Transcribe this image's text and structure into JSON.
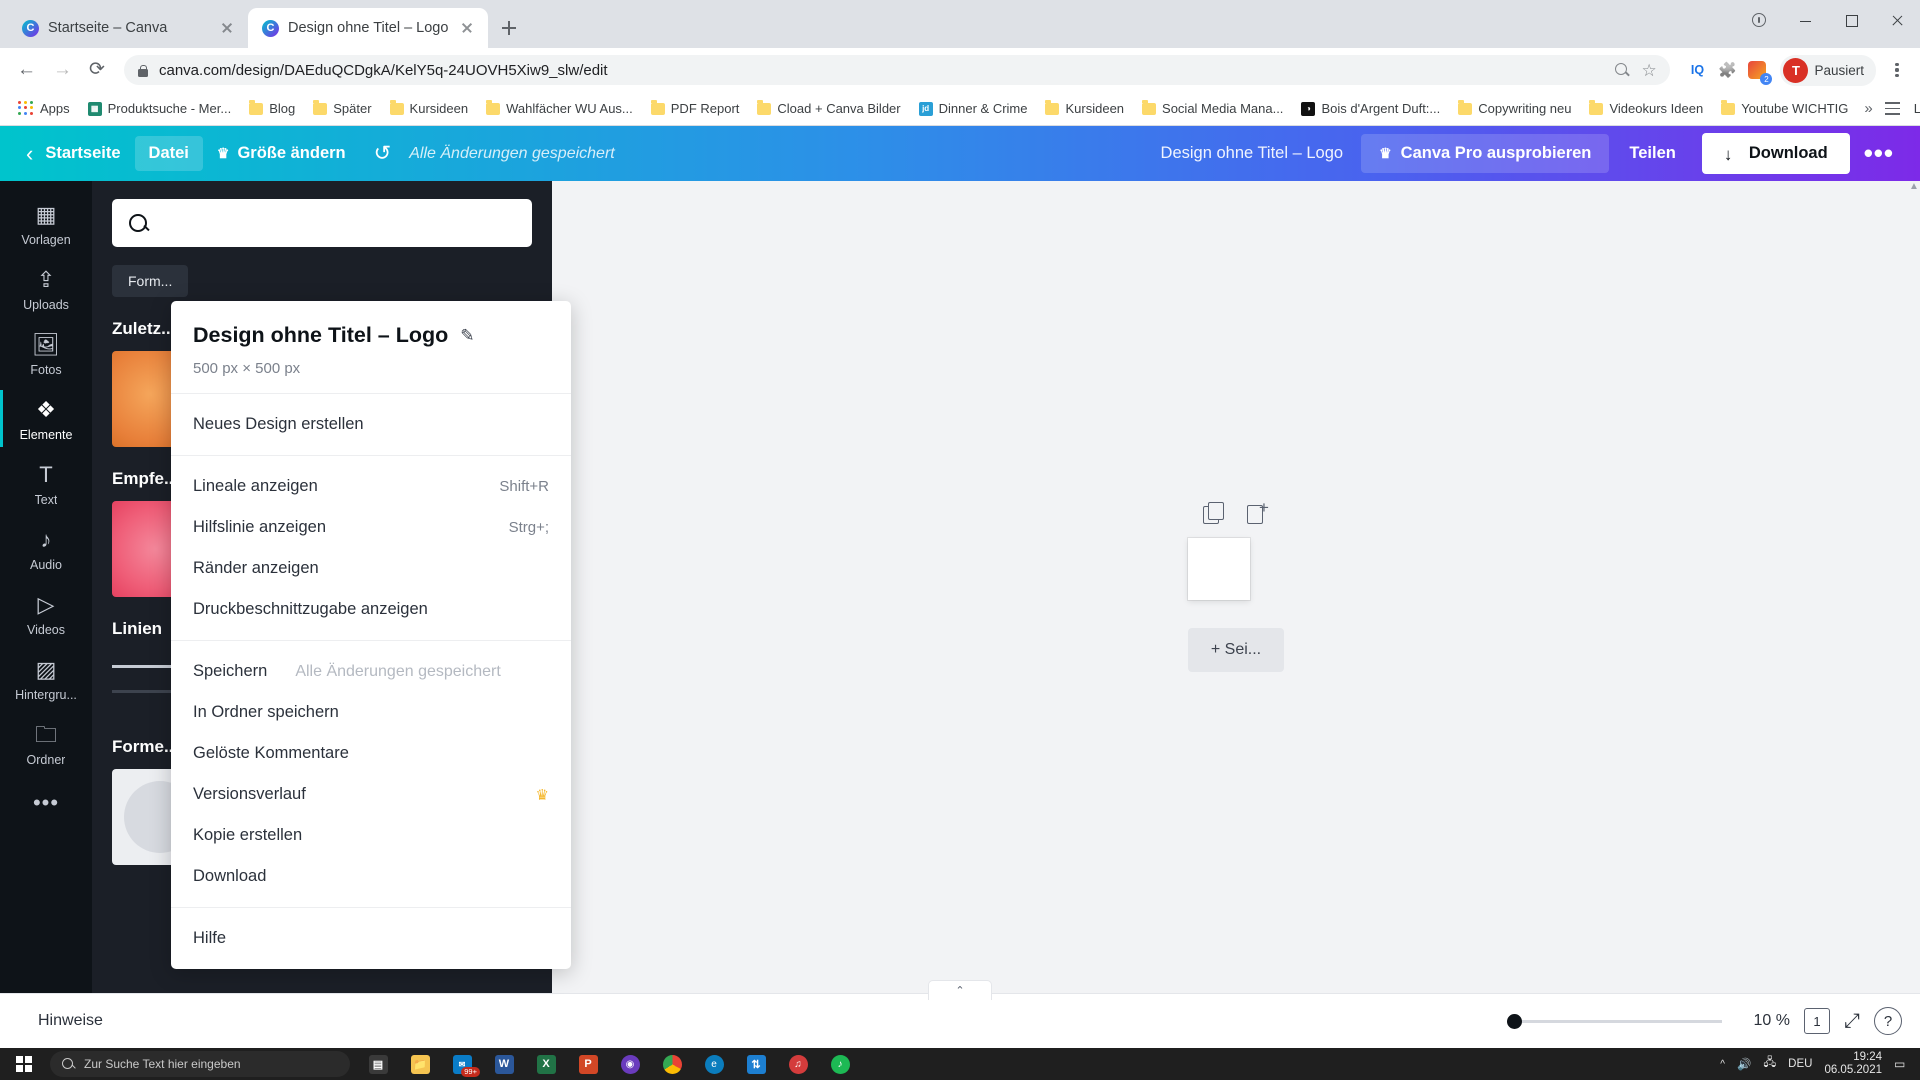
{
  "browser": {
    "tabs": [
      {
        "title": "Startseite – Canva",
        "active": false
      },
      {
        "title": "Design ohne Titel – Logo",
        "active": true
      }
    ],
    "newtab_label": "+",
    "url": "canva.com/design/DAEduQCDgkA/KelY5q-24UOVH5Xiw9_slw/edit",
    "profile_label": "Pausiert",
    "profile_initial": "T",
    "extension_badge": "2",
    "bookmarks": [
      {
        "label": "Apps",
        "icon": "apps-grid-icon"
      },
      {
        "label": "Produktsuche - Mer...",
        "icon": "teal-square-icon",
        "color": "#1f8a70"
      },
      {
        "label": "Blog",
        "icon": "folder-icon"
      },
      {
        "label": "Später",
        "icon": "folder-icon"
      },
      {
        "label": "Kursideen",
        "icon": "folder-icon"
      },
      {
        "label": "Wahlfächer WU Aus...",
        "icon": "folder-icon"
      },
      {
        "label": "PDF Report",
        "icon": "folder-icon"
      },
      {
        "label": "Cload + Canva Bilder",
        "icon": "folder-icon"
      },
      {
        "label": "Dinner & Crime",
        "icon": "jd-square-icon",
        "color": "#2a9fd6"
      },
      {
        "label": "Kursideen",
        "icon": "folder-icon"
      },
      {
        "label": "Social Media Mana...",
        "icon": "folder-icon"
      },
      {
        "label": "Bois d'Argent Duft:...",
        "icon": "dark-circle-icon",
        "color": "#111111"
      },
      {
        "label": "Copywriting neu",
        "icon": "folder-icon"
      },
      {
        "label": "Videokurs Ideen",
        "icon": "folder-icon"
      },
      {
        "label": "Youtube WICHTIG",
        "icon": "folder-icon"
      }
    ],
    "bookmarks_overflow": "»",
    "reading_list": "Leseliste"
  },
  "canva_toolbar": {
    "home": "Startseite",
    "file": "Datei",
    "resize": "Größe ändern",
    "saved_status": "Alle Änderungen gespeichert",
    "design_title": "Design ohne Titel – Logo",
    "pro": "Canva Pro ausprobieren",
    "share": "Teilen",
    "download": "Download",
    "more": "•••"
  },
  "file_menu": {
    "title": "Design ohne Titel – Logo",
    "dimensions": "500 px × 500 px",
    "groups": [
      {
        "items": [
          {
            "label": "Neues Design erstellen",
            "shortcut": "",
            "note": "",
            "pro": false
          }
        ]
      },
      {
        "items": [
          {
            "label": "Lineale anzeigen",
            "shortcut": "Shift+R",
            "note": "",
            "pro": false
          },
          {
            "label": "Hilfslinie anzeigen",
            "shortcut": "Strg+;",
            "note": "",
            "pro": false
          },
          {
            "label": "Ränder anzeigen",
            "shortcut": "",
            "note": "",
            "pro": false
          },
          {
            "label": "Druckbeschnittzugabe anzeigen",
            "shortcut": "",
            "note": "",
            "pro": false
          }
        ]
      },
      {
        "items": [
          {
            "label": "Speichern",
            "shortcut": "",
            "note": "Alle Änderungen gespeichert",
            "pro": false
          },
          {
            "label": "In Ordner speichern",
            "shortcut": "",
            "note": "",
            "pro": false
          },
          {
            "label": "Gelöste Kommentare",
            "shortcut": "",
            "note": "",
            "pro": false
          },
          {
            "label": "Versionsverlauf",
            "shortcut": "",
            "note": "",
            "pro": true
          },
          {
            "label": "Kopie erstellen",
            "shortcut": "",
            "note": "",
            "pro": false
          },
          {
            "label": "Download",
            "shortcut": "",
            "note": "",
            "pro": false
          }
        ]
      },
      {
        "items": [
          {
            "label": "Hilfe",
            "shortcut": "",
            "note": "",
            "pro": false
          }
        ]
      }
    ]
  },
  "sidebar": {
    "items": [
      {
        "label": "Vorlagen",
        "icon": "templates-icon",
        "active": false
      },
      {
        "label": "Uploads",
        "icon": "upload-icon",
        "active": false
      },
      {
        "label": "Fotos",
        "icon": "photo-icon",
        "active": false
      },
      {
        "label": "Elemente",
        "icon": "elements-icon",
        "active": true
      },
      {
        "label": "Text",
        "icon": "text-icon",
        "active": false
      },
      {
        "label": "Audio",
        "icon": "audio-icon",
        "active": false
      },
      {
        "label": "Videos",
        "icon": "video-icon",
        "active": false
      },
      {
        "label": "Hintergru...",
        "icon": "background-icon",
        "active": false
      },
      {
        "label": "Ordner",
        "icon": "folder-icon",
        "active": false
      }
    ],
    "more": "•••"
  },
  "panel": {
    "search_placeholder": "",
    "chips": [
      "Form..."
    ],
    "sections": [
      {
        "title": "Zuletz...",
        "kind": "thumbs"
      },
      {
        "title": "Empfe...",
        "kind": "thumbs"
      },
      {
        "title": "Linien",
        "kind": "lines"
      },
      {
        "title": "Forme...",
        "kind": "shapes"
      }
    ]
  },
  "canvas": {
    "add_page": "+ Sei...",
    "duplicate_icon": "duplicate-page-icon",
    "add_icon": "add-page-icon"
  },
  "status_bar": {
    "notes": "Hinweise",
    "zoom": "10 %",
    "page_count": "1",
    "help": "?",
    "collapse_icon": "chevron-up-icon",
    "expand_icon": "fullscreen-icon"
  },
  "taskbar": {
    "search_placeholder": "Zur Suche Text hier eingeben",
    "apps": [
      {
        "name": "task-view-icon",
        "label": "▤",
        "color": "#3a3a3a"
      },
      {
        "name": "file-explorer-icon",
        "label": "📁",
        "color": "#f5c451"
      },
      {
        "name": "mail-icon",
        "label": "99+",
        "color": "#0a7cc7"
      },
      {
        "name": "word-icon",
        "label": "W",
        "color": "#2b579a"
      },
      {
        "name": "excel-icon",
        "label": "X",
        "color": "#217346"
      },
      {
        "name": "powerpoint-icon",
        "label": "P",
        "color": "#d24726"
      },
      {
        "name": "media-icon",
        "label": "◉",
        "color": "#6a3bbd"
      },
      {
        "name": "chrome-icon",
        "label": "◎",
        "color": "#4285f4"
      },
      {
        "name": "edge-icon",
        "label": "e",
        "color": "#0b7dbd"
      },
      {
        "name": "transfer-icon",
        "label": "⇅",
        "color": "#1d7fd1"
      },
      {
        "name": "sound-icon",
        "label": "♫",
        "color": "#d43c3c"
      },
      {
        "name": "spotify-icon",
        "label": "♪",
        "color": "#1db954"
      }
    ],
    "language": "DEU",
    "time": "19:24",
    "date": "06.05.2021",
    "tray_chevron": "^"
  },
  "colors": {
    "canva_gradient_start": "#00c4cc",
    "canva_gradient_end": "#7d2ae8",
    "accent": "#00c4cc",
    "rail_bg": "#0e1318",
    "panel_bg": "#1b1f27",
    "crown": "#f5b82e"
  }
}
